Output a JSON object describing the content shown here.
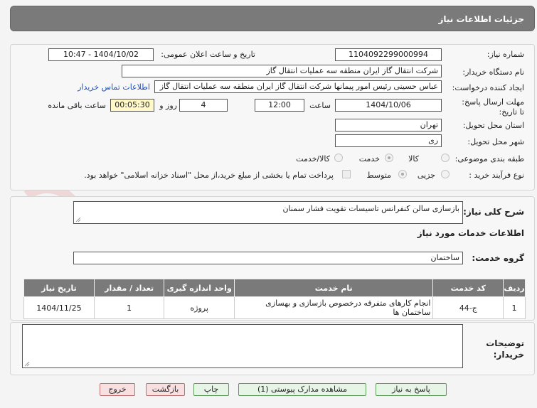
{
  "header": {
    "title": "جزئیات اطلاعات نیاز"
  },
  "form": {
    "need_number_label": "شماره نیاز:",
    "need_number": "1104092299000994",
    "announce_label": "تاریخ و ساعت اعلان عمومی:",
    "announce_value": "1404/10/02 - 10:47",
    "buyer_label": "نام دستگاه خریدار:",
    "buyer_value": "شرکت انتقال گاز ایران منطقه سه عملیات انتقال گاز",
    "creator_label": "ایجاد کننده درخواست:",
    "creator_value": "عباس حسینی رئیس امور پیمانها شرکت انتقال گاز ایران منطقه سه عملیات انتقال گاز",
    "contact_link": "اطلاعات تماس خریدار",
    "deadline_label": "مهلت ارسال پاسخ: تا تاریخ:",
    "deadline_date": "1404/10/06",
    "time_label": "ساعت",
    "deadline_time": "12:00",
    "days_value": "4",
    "days_label": "روز و",
    "remaining_value": "00:05:30",
    "remaining_label": "ساعت باقی مانده",
    "province_label": "استان محل تحویل:",
    "province_value": "تهران",
    "city_label": "شهر محل تحویل:",
    "city_value": "ری",
    "category_label": "طبقه بندی موضوعی:",
    "category_options": [
      "کالا",
      "خدمت",
      "کالا/خدمت"
    ],
    "process_label": "نوع فرآیند خرید :",
    "process_options": [
      "جزیی",
      "متوسط"
    ],
    "treasury_text": "پرداخت تمام یا بخشی از مبلغ خرید،از محل \"اسناد خزانه اسلامی\" خواهد بود."
  },
  "description": {
    "label": "شرح کلی نیاز:",
    "value": "بازسازی سالن کنفرانس تاسیسات تقویت فشار سمنان"
  },
  "services": {
    "section_title": "اطلاعات خدمات مورد نیاز",
    "group_label": "گروه خدمت:",
    "group_value": "ساختمان",
    "columns": [
      "ردیف",
      "کد خدمت",
      "نام خدمت",
      "واحد اندازه گیری",
      "تعداد / مقدار",
      "تاریخ نیاز"
    ],
    "rows": [
      {
        "row": "1",
        "code": "ج-44",
        "name": "انجام کارهای متفرقه درخصوص بازسازی و بهسازی ساختمان ها",
        "unit": "پروژه",
        "qty": "1",
        "date": "1404/11/25"
      }
    ]
  },
  "buyer_notes": {
    "label": "توضیحات خریدار:",
    "value": ""
  },
  "buttons": {
    "reply": "پاسخ به نیاز",
    "attachments": "مشاهده مدارک پیوستی (1)",
    "print": "چاپ",
    "back": "بازگشت",
    "exit": "خروج"
  },
  "watermark": {
    "text": "AriaTender.net"
  }
}
